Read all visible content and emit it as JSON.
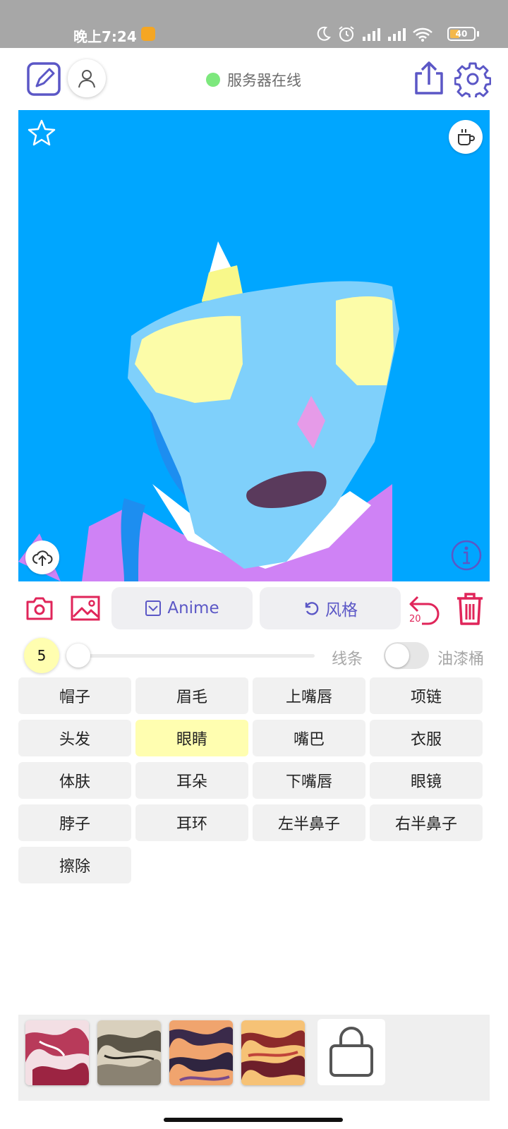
{
  "status_bar": {
    "time": "晚上7:24",
    "battery": "40",
    "battery_level": 0.4
  },
  "header": {
    "server_status": "服务器在线",
    "server_status_color": "#7de87d",
    "icons": [
      "edit-icon",
      "user-icon",
      "share-icon",
      "settings-icon"
    ]
  },
  "canvas": {
    "background": "#00a6ff",
    "icons": [
      "star-icon",
      "coffee-icon",
      "cloud-upload-icon",
      "info-icon"
    ]
  },
  "tools": {
    "anime_label": "Anime",
    "style_label": "风格",
    "undo_count": "20"
  },
  "brush": {
    "size": "5",
    "slider_level": 0,
    "line_label": "线条",
    "bucket_label": "油漆桶",
    "bucket_enabled": false
  },
  "parts": [
    {
      "label": "帽子",
      "active": false
    },
    {
      "label": "眉毛",
      "active": false
    },
    {
      "label": "上嘴唇",
      "active": false
    },
    {
      "label": "项链",
      "active": false
    },
    {
      "label": "头发",
      "active": false
    },
    {
      "label": "眼睛",
      "active": true
    },
    {
      "label": "嘴巴",
      "active": false
    },
    {
      "label": "衣服",
      "active": false
    },
    {
      "label": "体肤",
      "active": false
    },
    {
      "label": "耳朵",
      "active": false
    },
    {
      "label": "下嘴唇",
      "active": false
    },
    {
      "label": "眼镜",
      "active": false
    },
    {
      "label": "脖子",
      "active": false
    },
    {
      "label": "耳环",
      "active": false
    },
    {
      "label": "左半鼻子",
      "active": false
    },
    {
      "label": "右半鼻子",
      "active": false
    },
    {
      "label": "擦除",
      "active": false
    }
  ],
  "colors": {
    "accent_purple": "#5b57c6",
    "accent_red": "#e0255a",
    "active_chip": "#fffeb0"
  }
}
